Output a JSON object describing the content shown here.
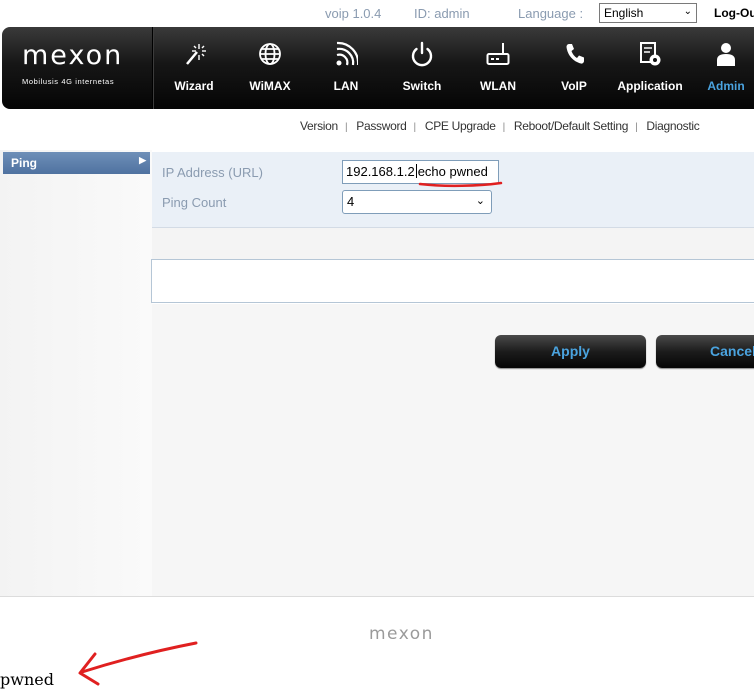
{
  "topbar": {
    "version": "voip 1.0.4",
    "id": "ID: admin",
    "language_label": "Language :",
    "language_value": "English",
    "logout": "Log-Out"
  },
  "logo": {
    "brand": "mexon",
    "tagline": "Mobilusis 4G internetas"
  },
  "nav": [
    {
      "label": "Wizard",
      "icon": "wand-icon"
    },
    {
      "label": "WiMAX",
      "icon": "globe-icon"
    },
    {
      "label": "LAN",
      "icon": "signal-icon"
    },
    {
      "label": "Switch",
      "icon": "power-icon"
    },
    {
      "label": "WLAN",
      "icon": "router-icon"
    },
    {
      "label": "VoIP",
      "icon": "phone-icon"
    },
    {
      "label": "Application",
      "icon": "app-settings-icon"
    },
    {
      "label": "Admin",
      "icon": "user-icon",
      "active": true
    }
  ],
  "submenu": [
    "Version",
    "Password",
    "CPE Upgrade",
    "Reboot/Default Setting",
    "Diagnostic"
  ],
  "sidebar": {
    "items": [
      {
        "label": "Ping",
        "active": true
      }
    ]
  },
  "form": {
    "ip_label": "IP Address (URL)",
    "ip_value_prefix": "192.168.1.2",
    "ip_value_injected": "echo pwned",
    "ping_count_label": "Ping Count",
    "ping_count_value": "4"
  },
  "buttons": {
    "apply": "Apply",
    "cancel": "Cancel"
  },
  "footer": {
    "logo": "mexon"
  },
  "output": {
    "text": "pwned"
  },
  "colors": {
    "accent": "#4aa3df",
    "header_dark": "#111111",
    "sidebar_active": "#5a7eab",
    "annotation_red": "#e02020"
  }
}
